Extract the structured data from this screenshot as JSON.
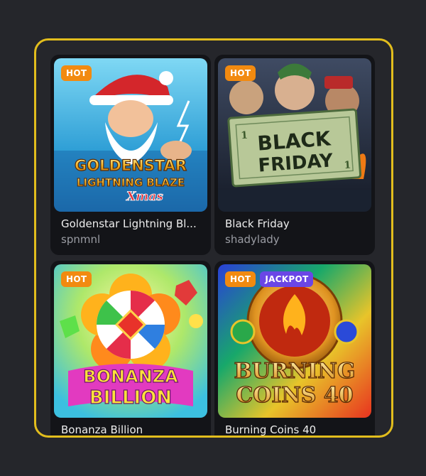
{
  "games": [
    {
      "title": "Goldenstar Lightning Blaze",
      "title_display": "Goldenstar Lightning Bl...",
      "provider": "spnmnl",
      "badges": [
        "HOT"
      ],
      "art_text": [
        "GOLDENSTAR",
        "LIGHTNING BLAZE",
        "Xmas"
      ]
    },
    {
      "title": "Black Friday",
      "title_display": "Black Friday",
      "provider": "shadylady",
      "badges": [
        "HOT"
      ],
      "art_text": [
        "BLACK",
        "FRIDAY",
        "1",
        "1"
      ]
    },
    {
      "title": "Bonanza Billion",
      "title_display": "Bonanza Billion",
      "provider": "",
      "badges": [
        "HOT"
      ],
      "art_text": [
        "BONANZA",
        "BILLION"
      ]
    },
    {
      "title": "Burning Coins 40",
      "title_display": "Burning Coins 40",
      "provider": "",
      "badges": [
        "HOT",
        "JACKPOT"
      ],
      "art_text": [
        "BURNING",
        "COINS 40"
      ]
    }
  ],
  "colors": {
    "background": "#25262b",
    "frame_border": "#e2bd1d",
    "card_bg": "#131418",
    "hot_badge": "#f28a10",
    "jackpot_badge": "#6a46e6"
  }
}
